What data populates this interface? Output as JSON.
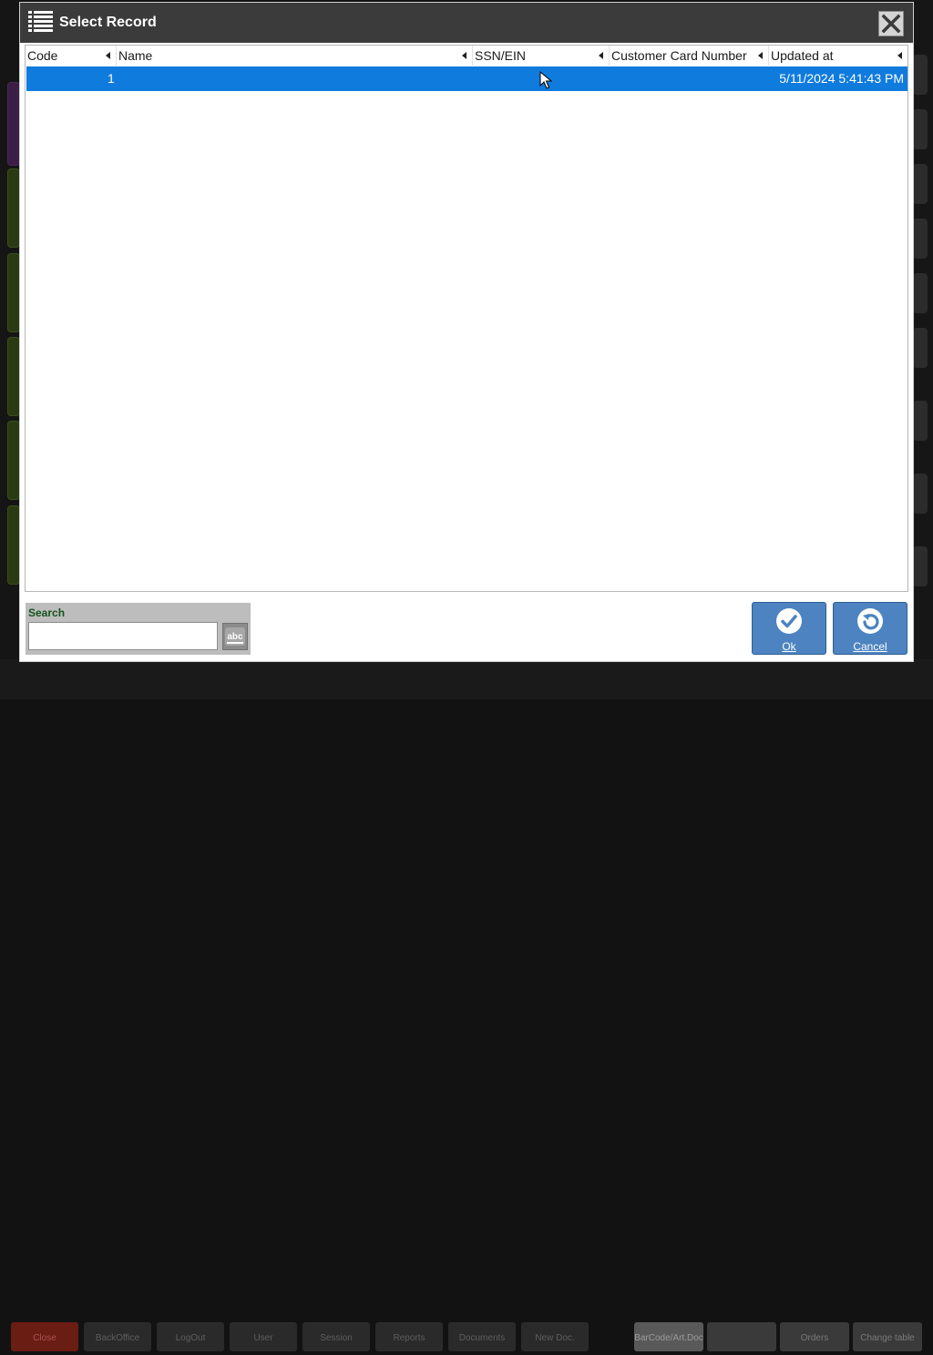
{
  "background_app": {
    "bottom_buttons": [
      "Close",
      "BackOffice",
      "LogOut",
      "User",
      "Session",
      "Reports",
      "Documents",
      "New Doc.",
      "BarCode/Art.Doc",
      "Orders",
      "Change table"
    ]
  },
  "dialog": {
    "title": "Select Record",
    "title_icon": "list-icon",
    "close_icon": "close-icon",
    "columns": [
      "Code",
      "Name",
      "SSN/EIN",
      "Customer Card Number",
      "Updated at"
    ],
    "rows": [
      {
        "code": "1",
        "name": "",
        "ssn_ein": "",
        "customer_card_number": "",
        "updated_at": "5/11/2024 5:41:43 PM",
        "selected": true
      }
    ],
    "search": {
      "label": "Search",
      "value": "",
      "placeholder": "",
      "keyboard_icon": "keyboard-abc-icon"
    },
    "buttons": {
      "ok": {
        "label": "Ok",
        "icon": "checkmark-icon"
      },
      "cancel": {
        "label": "Cancel",
        "icon": "undo-icon"
      }
    }
  },
  "colors": {
    "titlebar": "#3b3b3b",
    "selection": "#0f7bdd",
    "action_button": "#4c83c0",
    "search_label": "#14541c"
  }
}
